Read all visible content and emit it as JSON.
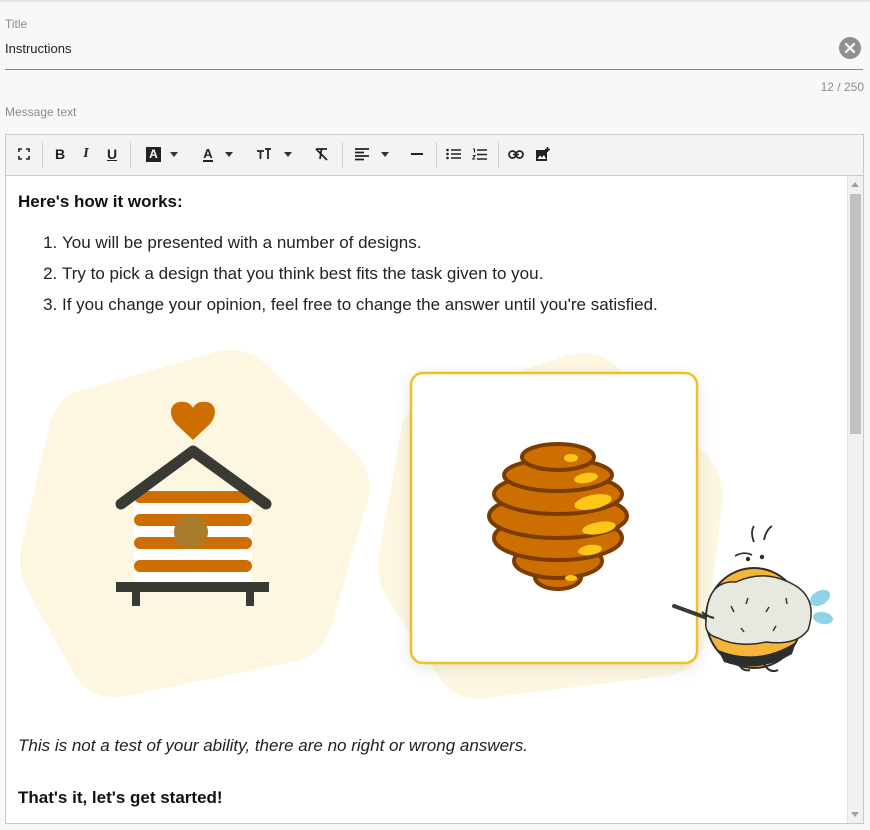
{
  "title_field": {
    "label": "Title",
    "value": "Instructions",
    "counter": "12 / 250"
  },
  "message_field": {
    "label": "Message text"
  },
  "toolbar": {
    "icons": [
      "fullscreen-icon",
      "bold-icon",
      "italic-icon",
      "underline-icon",
      "background-color-icon",
      "text-color-icon",
      "font-size-icon",
      "clear-format-icon",
      "align-icon",
      "horizontal-rule-icon",
      "bulleted-list-icon",
      "numbered-list-icon",
      "link-icon",
      "insert-image-icon"
    ],
    "bold_label": "B",
    "italic_label": "I",
    "underline_label": "U",
    "bg_color_label": "A",
    "text_color_label": "A"
  },
  "content": {
    "heading": "Here's how it works:",
    "steps": [
      "You will be presented with a number of designs.",
      "Try to pick a design that you think best fits the task given to you.",
      "If you change your opinion, feel free to change the answer until you're satisfied."
    ],
    "italic_note": "This is not a test of your ability, there are no right or wrong answers.",
    "closing": "That's it, let's get started!"
  },
  "colors": {
    "accent_yellow": "#f0c020",
    "honey_orange": "#cc6f00",
    "blob_cream": "#fdf7e2",
    "dark_gray": "#3a3a34"
  }
}
